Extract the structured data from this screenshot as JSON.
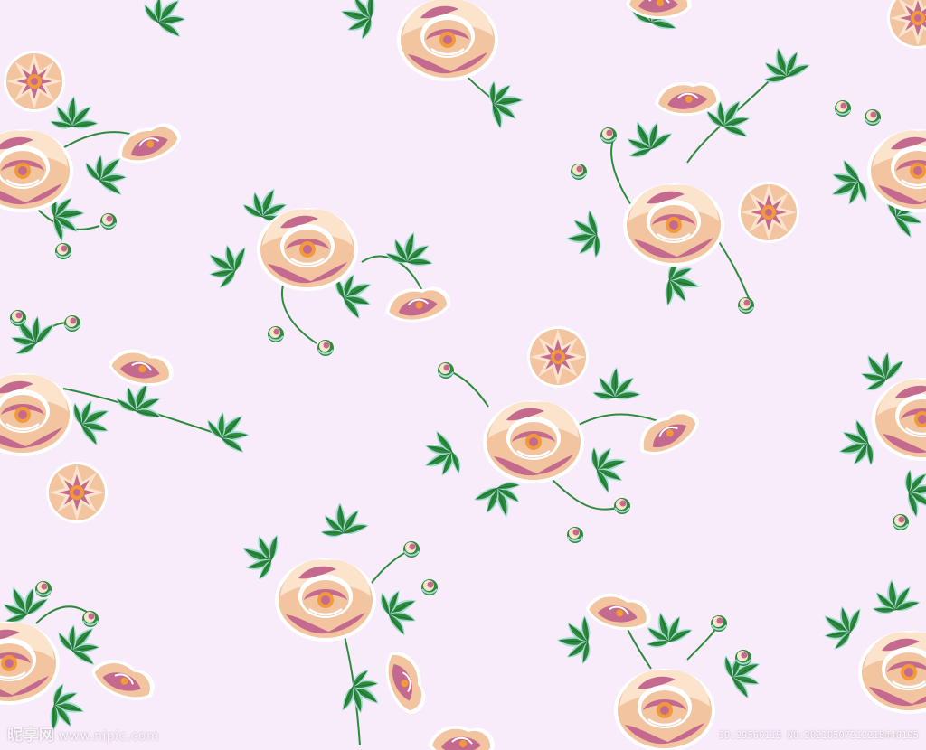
{
  "colors": {
    "background": "#F8ECFB",
    "petal_peach": "#F2C4A0",
    "petal_light": "#FBE3CC",
    "petal_pink": "#C56A8F",
    "petal_white": "#FFFFFF",
    "flower_center": "#F29A3A",
    "leaf_green": "#2E8B3E",
    "leaf_dark": "#1F6B2E",
    "leaf_mint": "#A8DCD6"
  },
  "watermark": {
    "logo_text": "昵享网",
    "site_text": "www.nipic.com",
    "id_text": "ID:29560115 NO:20210507212218440195"
  },
  "icons": [
    "peony-flower-icon",
    "leaf-sprig-icon",
    "flower-bud-icon"
  ]
}
